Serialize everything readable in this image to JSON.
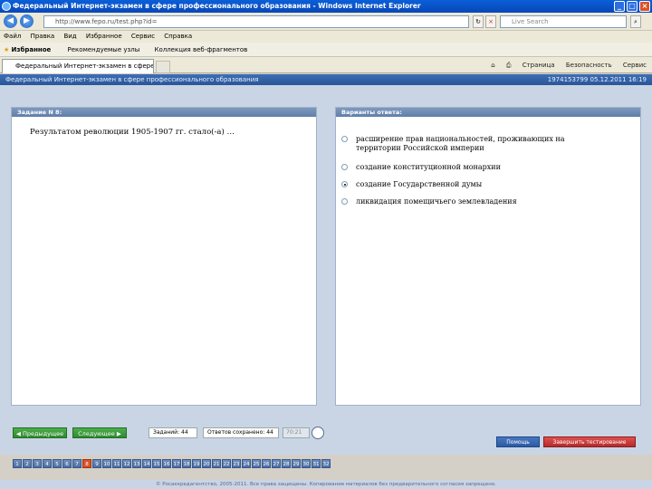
{
  "window": {
    "title": "Федеральный Интернет-экзамен в сфере профессионального образования - Windows Internet Explorer"
  },
  "browser": {
    "address": "http://www.fepo.ru/test.php?id=",
    "search_placeholder": "Live Search",
    "menu": [
      "Файл",
      "Правка",
      "Вид",
      "Избранное",
      "Сервис",
      "Справка"
    ],
    "favorites_label": "Избранное",
    "favorites": [
      "Рекомендуемые узлы",
      "Коллекция веб-фрагментов"
    ],
    "tab_title": "Федеральный Интернет-экзамен в сфере...",
    "tools": [
      "Страница",
      "Безопасность",
      "Сервис"
    ]
  },
  "app": {
    "header_title": "Федеральный Интернет-экзамен в сфере профессионального образования",
    "session_id": "1974153799 05.12.2011 16:19"
  },
  "task": {
    "header": "Задание N 8:",
    "question": "Результатом революции 1905-1907 гг. стало(-а) …"
  },
  "answers": {
    "header": "Варианты ответа:",
    "options": [
      {
        "text": "расширение прав национальностей, проживающих на территории Российской империи",
        "selected": false
      },
      {
        "text": "создание конституционной монархии",
        "selected": false
      },
      {
        "text": "создание Государственной думы",
        "selected": true
      },
      {
        "text": "ликвидация помещичьего землевладения",
        "selected": false
      }
    ]
  },
  "navigation": {
    "prev_label": "Предыдущее",
    "next_label": "Следующее",
    "tasks_total": "Заданий: 44",
    "answered": "Ответов сохранено: 44",
    "timer": "70:21",
    "help_label": "Помощь",
    "finish_label": "Завершить тестирование"
  },
  "pages": {
    "numbers": [
      "1",
      "2",
      "3",
      "4",
      "5",
      "6",
      "7",
      "8",
      "9",
      "10",
      "11",
      "12",
      "13",
      "14",
      "15",
      "16",
      "17",
      "18",
      "19",
      "20",
      "21",
      "22",
      "23",
      "24",
      "25",
      "26",
      "27",
      "28",
      "29",
      "30",
      "31",
      "32"
    ],
    "current": "8"
  },
  "footer": "© Росаккредагентство, 2005-2011. Все права защищены. Копирование материалов без предварительного согласия запрещено."
}
